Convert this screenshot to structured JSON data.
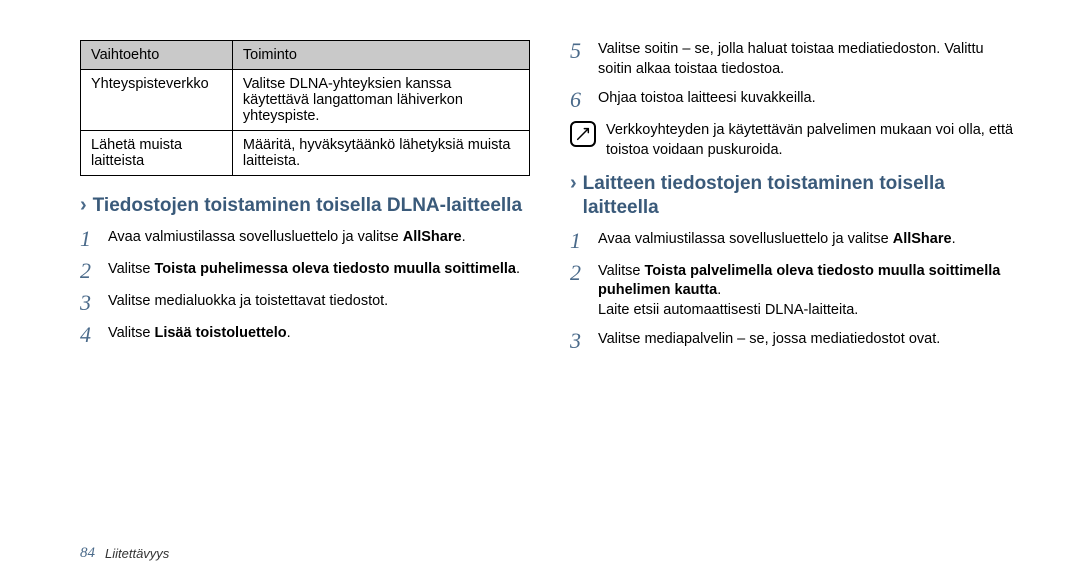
{
  "table": {
    "headers": [
      "Vaihtoehto",
      "Toiminto"
    ],
    "rows": [
      [
        "Yhteyspisteverkko",
        "Valitse DLNA-yhteyksien kanssa käytettävä langattoman lähiverkon yhteyspiste."
      ],
      [
        "Lähetä muista laitteista",
        "Määritä, hyväksytäänkö lähetyksiä muista laitteista."
      ]
    ]
  },
  "left_section": {
    "title": "Tiedostojen toistaminen toisella DLNA-laitteella",
    "steps": [
      {
        "n": "1",
        "html": "Avaa valmiustilassa sovellusluettelo ja valitse <b>AllShare</b>."
      },
      {
        "n": "2",
        "html": "Valitse <b>Toista puhelimessa oleva tiedosto muulla soittimella</b>."
      },
      {
        "n": "3",
        "html": "Valitse medialuokka ja toistettavat tiedostot."
      },
      {
        "n": "4",
        "html": "Valitse <b>Lisää toistoluettelo</b>."
      }
    ]
  },
  "right_top_steps": [
    {
      "n": "5",
      "html": "Valitse soitin – se, jolla haluat toistaa mediatiedoston. Valittu soitin alkaa toistaa tiedostoa."
    },
    {
      "n": "6",
      "html": "Ohjaa toistoa laitteesi kuvakkeilla."
    }
  ],
  "note_text": "Verkkoyhteyden ja käytettävän palvelimen mukaan voi olla, että toistoa voidaan puskuroida.",
  "right_section": {
    "title": "Laitteen tiedostojen toistaminen toisella laitteella",
    "steps": [
      {
        "n": "1",
        "html": "Avaa valmiustilassa sovellusluettelo ja valitse <b>AllShare</b>."
      },
      {
        "n": "2",
        "html": "Valitse <b>Toista palvelimella oleva tiedosto muulla soittimella puhelimen kautta</b>.<br>Laite etsii automaattisesti DLNA-laitteita."
      },
      {
        "n": "3",
        "html": "Valitse mediapalvelin – se, jossa mediatiedostot ovat."
      }
    ]
  },
  "footer": {
    "page": "84",
    "section": "Liitettävyys"
  }
}
